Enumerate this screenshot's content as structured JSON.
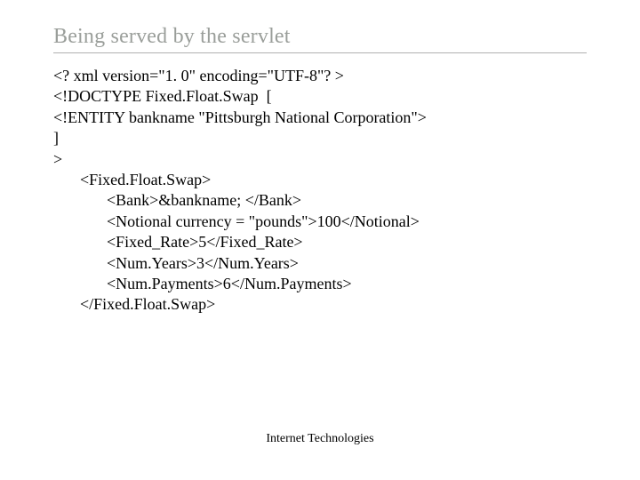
{
  "title": "Being served by the servlet",
  "code": {
    "l1": "<? xml version=\"1. 0\" encoding=\"UTF-8\"? >",
    "l2": "<!DOCTYPE Fixed.Float.Swap  [",
    "l3": "<!ENTITY bankname \"Pittsburgh National Corporation\">",
    "l4": "]",
    "l5": ">",
    "l6": "<Fixed.Float.Swap>",
    "l7": "<Bank>&bankname; </Bank>",
    "l8": "<Notional currency = \"pounds\">100</Notional>",
    "l9": "<Fixed_Rate>5</Fixed_Rate>",
    "l10": "<Num.Years>3</Num.Years>",
    "l11": "<Num.Payments>6</Num.Payments>",
    "l12": "</Fixed.Float.Swap>"
  },
  "footer": "Internet Technologies"
}
